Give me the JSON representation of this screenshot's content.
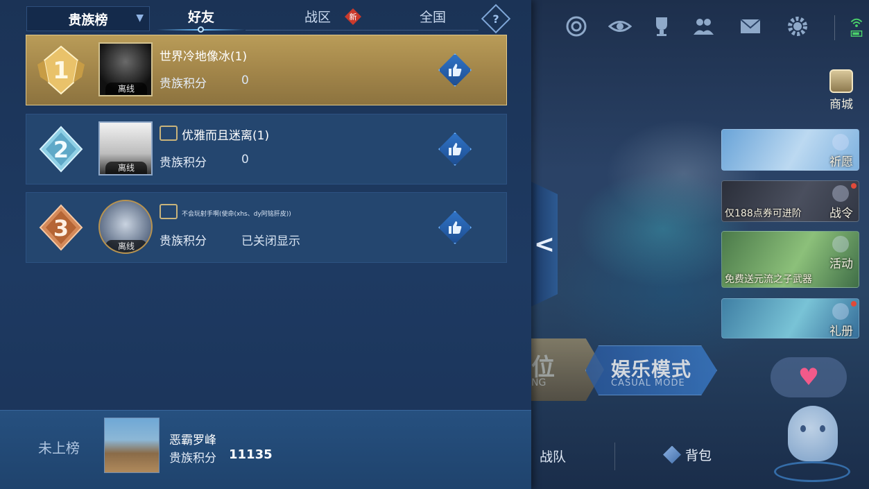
{
  "leaderboard": {
    "dropdown_label": "贵族榜",
    "tabs": [
      {
        "label": "好友",
        "active": true
      },
      {
        "label": "战区",
        "badge": "新"
      },
      {
        "label": "全国"
      }
    ],
    "help_icon_glyph": "?",
    "offline_label": "离线",
    "rows": [
      {
        "rank": "1",
        "name": "世界冷地像冰(1)",
        "score_label": "贵族积分",
        "score_value": "0",
        "medal": "gold"
      },
      {
        "rank": "2",
        "name": "优雅而且迷离(1)",
        "score_label": "贵族积分",
        "score_value": "0",
        "medal": "silver"
      },
      {
        "rank": "3",
        "name": "不会玩射手啊(使命(xhs、dy阿铭肝皮))",
        "score_label": "贵族积分",
        "score_value": "已关闭显示",
        "medal": "bronze"
      }
    ],
    "me": {
      "rank_text": "未上榜",
      "name": "恶霸罗峰",
      "score_label": "贵族积分",
      "score_value": "11135"
    }
  },
  "lobby": {
    "top_icons": [
      "target-icon",
      "eye-icon",
      "trophy-icon",
      "friends-icon",
      "mail-icon",
      "settings-icon"
    ],
    "shop_label": "商城",
    "side_cards": [
      {
        "label": "祈愿",
        "sub": ""
      },
      {
        "label": "战令",
        "sub": "仅188点券可进阶"
      },
      {
        "label": "活动",
        "sub": "免费送元流之子武器"
      },
      {
        "label": "礼册",
        "sub": ""
      }
    ],
    "rank_fragment": "位",
    "rank_fragment_sub": "NG",
    "casual_mode": "娱乐模式",
    "casual_mode_en": "CASUAL MODE",
    "bottom_team": "战队",
    "bottom_bag": "背包",
    "heart_glyph": "♥",
    "collapse_glyph": "<"
  },
  "colors": {
    "gold_row": "#b99c58",
    "row_blue": "#24466f",
    "accent": "#6fc3ff",
    "new_badge": "#c93a2c"
  }
}
